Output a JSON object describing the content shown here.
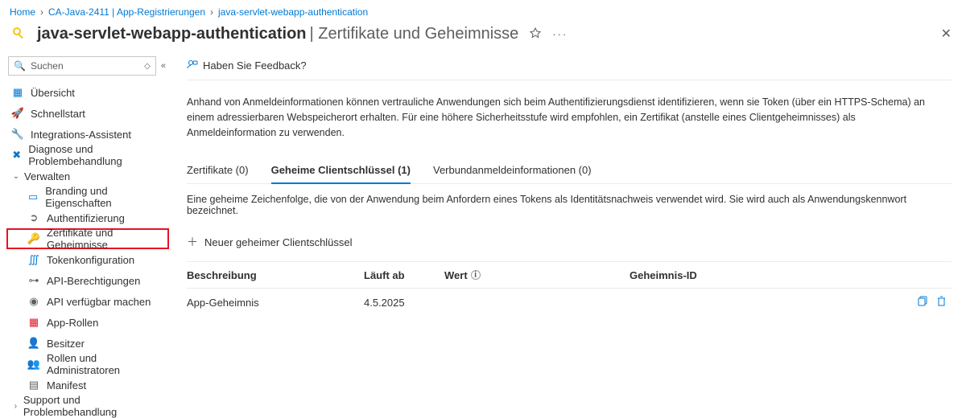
{
  "breadcrumb": {
    "home": "Home",
    "level2": "CA-Java-2411 | App-Registrierungen",
    "level3": "java-servlet-webapp-authentication"
  },
  "header": {
    "title_primary": "java-servlet-webapp-authentication",
    "title_secondary": "| Zertifikate und Geheimnisse"
  },
  "search": {
    "placeholder": "Suchen"
  },
  "sidebar": {
    "overview": "Übersicht",
    "quickstart": "Schnellstart",
    "integration": "Integrations-Assistent",
    "diagnose": "Diagnose und Problembehandlung",
    "manage_group": "Verwalten",
    "branding": "Branding und Eigenschaften",
    "auth": "Authentifizierung",
    "certs": "Zertifikate und Geheimnisse",
    "token": "Tokenkonfiguration",
    "api_perm": "API-Berechtigungen",
    "api_expose": "API verfügbar machen",
    "app_roles": "App-Rollen",
    "owners": "Besitzer",
    "roles_admins": "Rollen und Administratoren",
    "manifest": "Manifest",
    "support_group": "Support und Problembehandlung"
  },
  "toolbar": {
    "feedback": "Haben Sie Feedback?"
  },
  "intro_text": "Anhand von Anmeldeinformationen können vertrauliche Anwendungen sich beim Authentifizierungsdienst identifizieren, wenn sie Token (über ein HTTPS-Schema) an einem adressierbaren Webspeicherort erhalten. Für eine höhere Sicherheitsstufe wird empfohlen, ein Zertifikat (anstelle eines Clientgeheimnisses) als Anmeldeinformation zu verwenden.",
  "tabs": {
    "certs": "Zertifikate (0)",
    "secrets": "Geheime Clientschlüssel (1)",
    "federated": "Verbundanmeldeinformationen (0)"
  },
  "tab_desc": "Eine geheime Zeichenfolge, die von der Anwendung beim Anfordern eines Tokens als Identitätsnachweis verwendet wird. Sie wird auch als Anwendungskennwort bezeichnet.",
  "actions": {
    "new_secret": "Neuer geheimer Clientschlüssel"
  },
  "table": {
    "h_desc": "Beschreibung",
    "h_exp": "Läuft ab",
    "h_val": "Wert",
    "h_id": "Geheimnis-ID",
    "rows": [
      {
        "desc": "App-Geheimnis",
        "exp": "4.5.2025",
        "val": "",
        "id": ""
      }
    ]
  }
}
